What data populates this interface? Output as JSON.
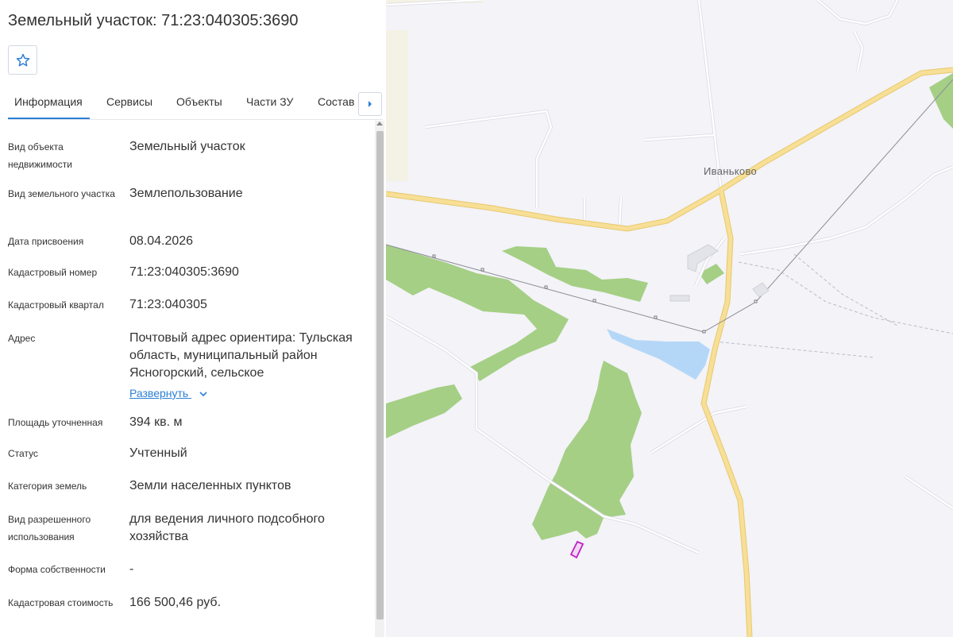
{
  "panel": {
    "title": "Земельный участок: 71:23:040305:3690",
    "favorite_icon": "star-icon",
    "tabs": [
      {
        "label": "Информация",
        "active": true
      },
      {
        "label": "Сервисы",
        "active": false
      },
      {
        "label": "Объекты",
        "active": false
      },
      {
        "label": "Части ЗУ",
        "active": false
      },
      {
        "label": "Состав",
        "active": false
      }
    ],
    "tabs_next_icon": "chevron-right-icon",
    "fields": [
      {
        "label": "Вид объекта недвижимости",
        "value": "Земельный участок"
      },
      {
        "label": "Вид земельного участка",
        "value": "Землепользование"
      },
      {
        "label": "Дата присвоения",
        "value": "08.04.2026"
      },
      {
        "label": "Кадастровый номер",
        "value": "71:23:040305:3690"
      },
      {
        "label": "Кадастровый квартал",
        "value": "71:23:040305"
      },
      {
        "label": "Адрес",
        "value": "Почтовый адрес ориентира: Тульская область, муниципальный район Ясногорский, сельское"
      },
      {
        "label": "Площадь уточненная",
        "value": "394 кв. м"
      },
      {
        "label": "Статус",
        "value": "Учтенный"
      },
      {
        "label": "Категория земель",
        "value": "Земли населенных пунктов"
      },
      {
        "label": "Вид разрешенного использования",
        "value": "для ведения личного подсобного хозяйства"
      },
      {
        "label": "Форма собственности",
        "value": "-"
      },
      {
        "label": "Кадастровая стоимость",
        "value": "166 500,46 руб."
      }
    ],
    "expand_label": "Развернуть"
  },
  "map": {
    "place_label": "Иваньково",
    "colors": {
      "background": "#f3f3f8",
      "road_main": "#f7df96",
      "road_minor": "#ffffff",
      "forest": "#a5cf85",
      "water": "#b5d7f7",
      "parcel_outline": "#c21fc3",
      "accent": "#2c7fd5"
    }
  }
}
